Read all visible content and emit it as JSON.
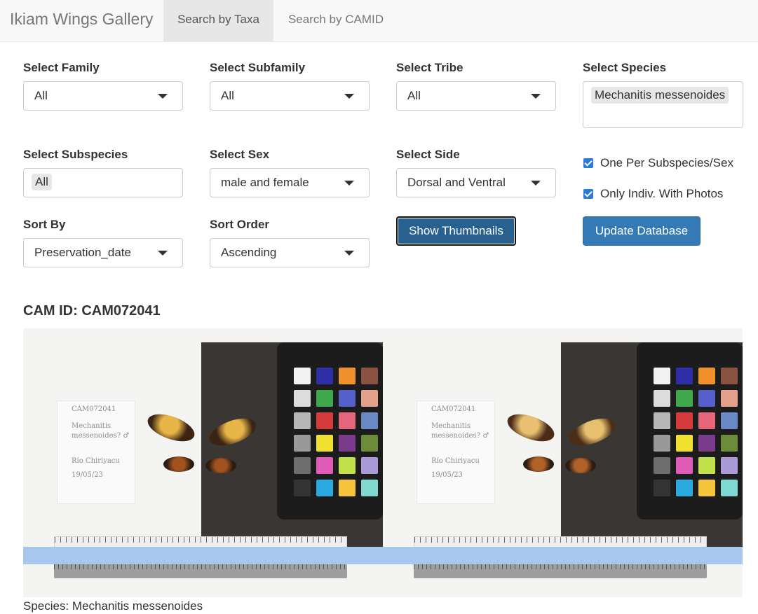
{
  "navbar": {
    "brand": "Ikiam Wings Gallery",
    "tabs": [
      {
        "label": "Search by Taxa",
        "active": true
      },
      {
        "label": "Search by CAMID",
        "active": false
      }
    ]
  },
  "filters": {
    "family": {
      "label": "Select Family",
      "value": "All"
    },
    "subfamily": {
      "label": "Select Subfamily",
      "value": "All"
    },
    "tribe": {
      "label": "Select Tribe",
      "value": "All"
    },
    "species": {
      "label": "Select Species",
      "selected": [
        "Mechanitis messenoides"
      ]
    },
    "subspecies": {
      "label": "Select Subspecies",
      "selected": [
        "All"
      ]
    },
    "sex": {
      "label": "Select Sex",
      "value": "male and female"
    },
    "side": {
      "label": "Select Side",
      "value": "Dorsal and Ventral"
    },
    "sort_by": {
      "label": "Sort By",
      "value": "Preservation_date"
    },
    "sort_order": {
      "label": "Sort Order",
      "value": "Ascending"
    }
  },
  "checkboxes": [
    {
      "label": "One Per Subspecies/Sex",
      "checked": true
    },
    {
      "label": "Only Indiv. With Photos",
      "checked": true
    }
  ],
  "buttons": {
    "thumbnails": "Show Thumbnails",
    "update": "Update Database"
  },
  "result": {
    "cam_id": "CAM ID: CAM072041",
    "caption": "Species: Mechanitis messenoides",
    "label_notes": [
      "CAM072041",
      "Mechanitis",
      "messenoides? ♂",
      "Río Chiriyacu",
      "19/05/23"
    ]
  },
  "colors": {
    "brand_blue": "#337ab7",
    "active_button": "#286090",
    "checkbox": "#2b7bd6",
    "tape": "#a7c7ec",
    "color_checker": [
      "#f2f2f2",
      "#2e2fa8",
      "#f0902a",
      "#8a5240",
      "#dcdcdc",
      "#3fa84c",
      "#5560cc",
      "#e3a18c",
      "#b8b8b8",
      "#d63b3b",
      "#e5667a",
      "#6a88c4",
      "#999999",
      "#f0e030",
      "#7a3b8c",
      "#6d8c3a",
      "#6e6e6e",
      "#e05ab8",
      "#c2e04a",
      "#a99ad8",
      "#333333",
      "#2aa8e0",
      "#f5c43a",
      "#80d9d0"
    ]
  }
}
